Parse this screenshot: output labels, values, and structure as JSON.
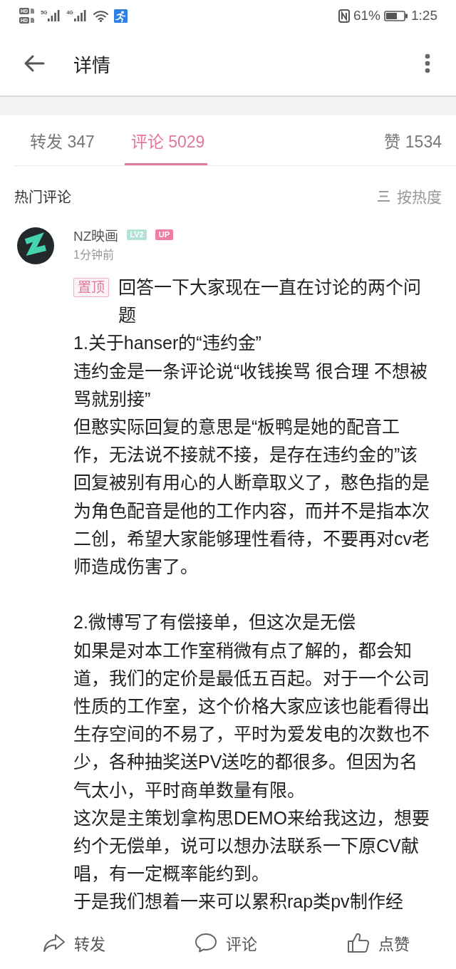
{
  "status_bar": {
    "sim_labels": [
      "HD",
      "HD"
    ],
    "networks": [
      "5G",
      "4G"
    ],
    "battery_percent": "61%",
    "time": "1:25"
  },
  "header": {
    "title": "详情"
  },
  "tabs": [
    {
      "text": "转发 347",
      "selected": false
    },
    {
      "text": "评论 5029",
      "selected": true
    },
    {
      "text": "赞 1534",
      "selected": false
    }
  ],
  "comments_header": {
    "title": "热门评论",
    "sort": "按热度"
  },
  "comment": {
    "author": "NZ映画",
    "level_badge": "LV2",
    "up_badge": "UP",
    "time": "1分钟前",
    "pinned_label": "置顶",
    "sections": [
      [
        "回答一下大家现在一直在讨论的两个问题",
        "1.关于hanser的“违约金”",
        "违约金是一条评论说“收钱挨骂 很合理 不想被骂就别接”",
        "但憨实际回复的意思是“板鸭是她的配音工作，无法说不接就不接，是存在违约金的”该回复被别有用心的人断章取义了，憨色指的是为角色配音是他的工作内容，而并不是指本次二创，希望大家能够理性看待，不要再对cv老师造成伤害了。"
      ],
      [
        "2.微博写了有偿接单，但这次是无偿",
        "如果是对本工作室稍微有点了解的，都会知道，我们的定价是最低五百起。对于一个公司性质的工作室，这个价格大家应该也能看得出生存空间的不易了，平时为爱发电的次数也不少，各种抽奖送PV送吃的都很多。但因为名气太小，平时商单数量有限。",
        "这次是主策划拿构思DEMO来给我这边，想要约个无偿单，说可以想办法联系一下原CV献唱，有一定概率能约到。",
        "于是我们想着一来可以累积rap类pv制作经"
      ]
    ]
  },
  "action_bar": [
    {
      "kind": "share",
      "label": "转发"
    },
    {
      "kind": "comment",
      "label": "评论"
    },
    {
      "kind": "like",
      "label": "点赞"
    }
  ]
}
